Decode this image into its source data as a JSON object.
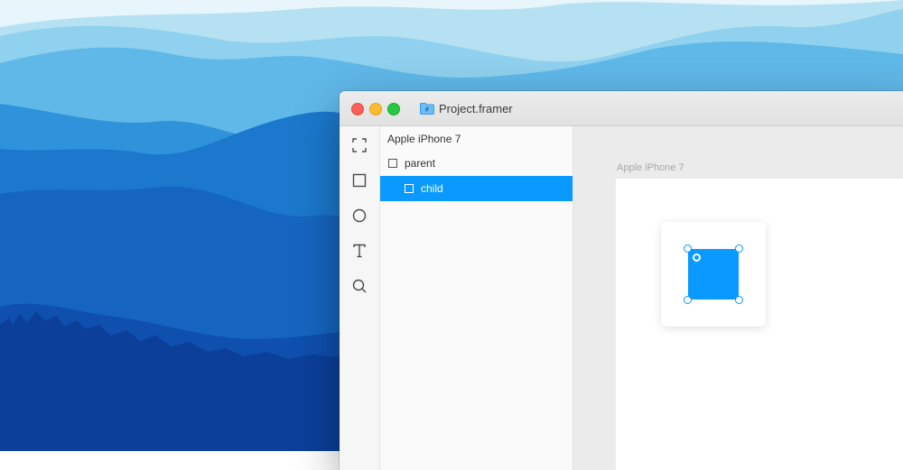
{
  "window": {
    "title": "Project.framer"
  },
  "toolbar": {
    "tools": [
      {
        "icon": "frame-select-icon"
      },
      {
        "icon": "rectangle-icon"
      },
      {
        "icon": "oval-icon"
      },
      {
        "icon": "text-icon"
      },
      {
        "icon": "search-icon"
      }
    ]
  },
  "layers": {
    "device_name": "Apple iPhone 7",
    "items": [
      {
        "label": "parent"
      },
      {
        "label": "child"
      }
    ]
  },
  "canvas": {
    "device_label": "Apple iPhone 7"
  },
  "colors": {
    "accent": "#0a99ff",
    "canvas_bg": "#ebebeb",
    "sidebar_bg": "#fafafa"
  }
}
